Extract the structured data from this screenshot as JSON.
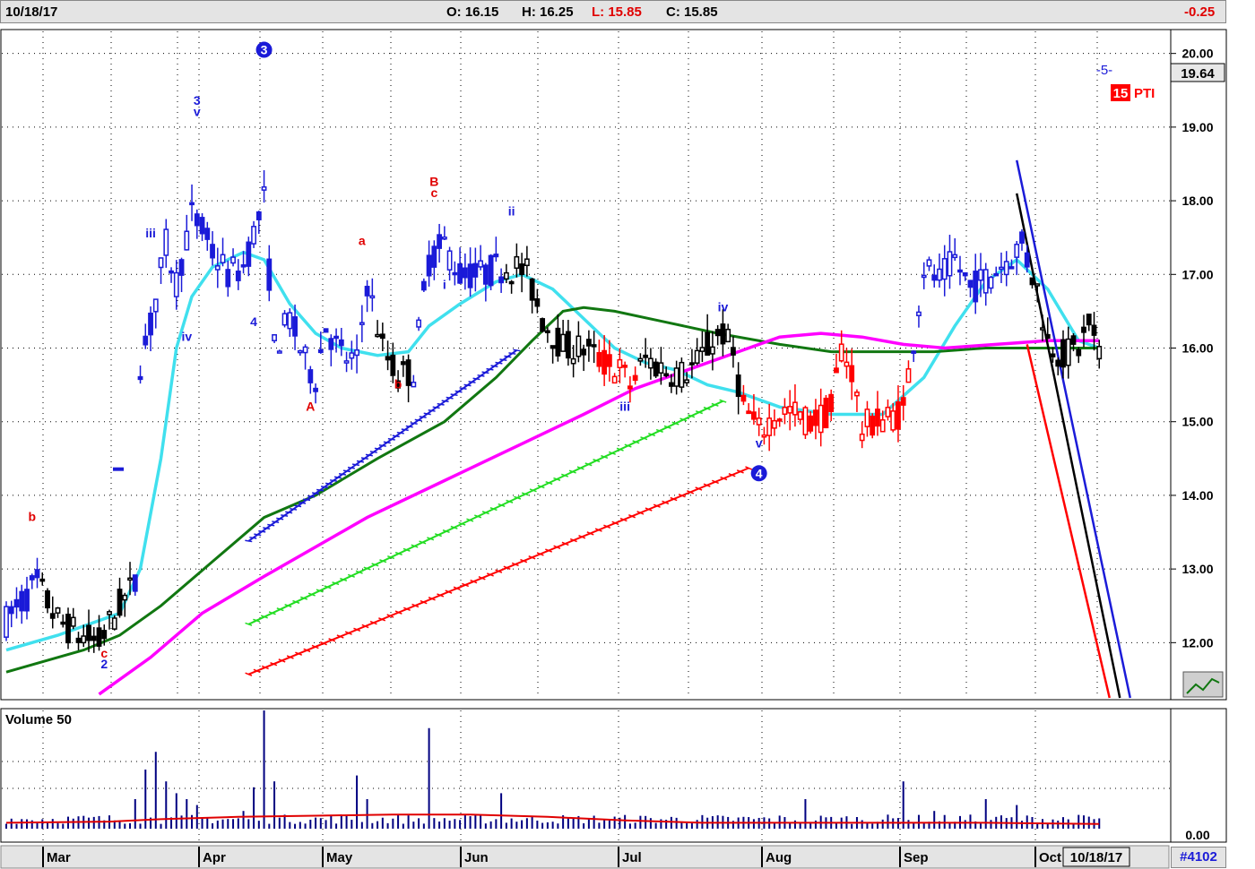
{
  "header": {
    "date": "10/18/17",
    "open": "O: 16.15",
    "high": "H: 16.25",
    "low": "L: 15.85",
    "close": "C: 15.85",
    "change": "-0.25"
  },
  "price_badge": "19.64",
  "pti": {
    "value": "15",
    "label": "PTI"
  },
  "wave_label": "-5-",
  "volume_label": "Volume 50",
  "volume_zero": "0.00",
  "date_box": "10/18/17",
  "chart_id": "#4102",
  "colors": {
    "up": "#1b1bd8",
    "down": "#000000",
    "red": "#ff0000",
    "cyan": "#40e0ee",
    "green": "#117711",
    "magenta": "#ff00ff",
    "lime": "#22dd22"
  },
  "chart_data": [
    {
      "type": "candlestick",
      "ylim": [
        11.25,
        20.3
      ],
      "y_ticks": [
        "20.00",
        "19.00",
        "18.00",
        "17.00",
        "16.00",
        "15.00",
        "14.00",
        "13.00",
        "12.00"
      ],
      "months": [
        "Mar",
        "Apr",
        "May",
        "Jun",
        "Jul",
        "Aug",
        "Sep",
        "Oct"
      ],
      "wave_labels": [
        {
          "text": "b",
          "color": "red",
          "bar": 5,
          "price": 13.65
        },
        {
          "text": "c",
          "color": "red",
          "bar": 19,
          "price": 11.8
        },
        {
          "text": "2",
          "color": "blue",
          "bar": 19,
          "price": 11.65
        },
        {
          "text": "iii",
          "color": "blue",
          "bar": 28,
          "price": 17.5
        },
        {
          "text": "3",
          "color": "blue",
          "bar": 37,
          "price": 19.3
        },
        {
          "text": "v",
          "color": "blue",
          "bar": 37,
          "price": 19.15
        },
        {
          "text": "iv",
          "color": "blue",
          "bar": 35,
          "price": 16.1
        },
        {
          "text": "5",
          "color": "blue",
          "bar": 50,
          "price": 19.95
        },
        {
          "text": "4",
          "color": "blue",
          "bar": 48,
          "price": 16.3
        },
        {
          "text": "A",
          "color": "red",
          "bar": 59,
          "price": 15.15
        },
        {
          "text": "a",
          "color": "red",
          "bar": 69,
          "price": 17.4
        },
        {
          "text": "b",
          "color": "red",
          "bar": 76,
          "price": 15.45
        },
        {
          "text": "B",
          "color": "red",
          "bar": 83,
          "price": 18.2
        },
        {
          "text": "c",
          "color": "red",
          "bar": 83,
          "price": 18.05
        },
        {
          "text": "i",
          "color": "blue",
          "bar": 85,
          "price": 16.8
        },
        {
          "text": "ii",
          "color": "blue",
          "bar": 98,
          "price": 17.8
        },
        {
          "text": "iii",
          "color": "blue",
          "bar": 120,
          "price": 15.15
        },
        {
          "text": "iv",
          "color": "blue",
          "bar": 139,
          "price": 16.5
        },
        {
          "text": "v",
          "color": "blue",
          "bar": 146,
          "price": 14.65
        }
      ],
      "wave_circles": [
        {
          "text": "3",
          "bar": 50,
          "price": 20.05
        },
        {
          "text": "4",
          "bar": 146,
          "price": 14.3
        }
      ]
    },
    {
      "type": "bar",
      "title": "Volume 50",
      "ylim": [
        0,
        1
      ],
      "y_ticks": [
        "0.00"
      ]
    }
  ]
}
